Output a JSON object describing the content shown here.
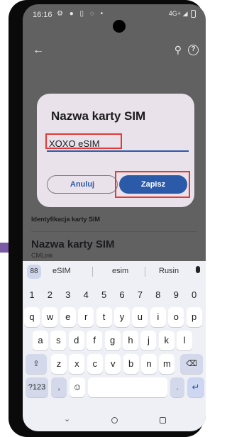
{
  "status_bar": {
    "time": "16:16",
    "icons": "⚙ ● ▯ ◌ •",
    "network": "4G+"
  },
  "app_bar": {
    "back_icon": "←",
    "search_icon": "⚲",
    "help_icon": "?"
  },
  "dialog": {
    "title": "Nazwa karty SIM",
    "input_value": "XOXO eSIM",
    "cancel_label": "Anuluj",
    "save_label": "Zapisz"
  },
  "settings": {
    "section_header": "Identyfikacja karty SIM",
    "item_title": "Nazwa karty SIM",
    "item_value": "CMLink"
  },
  "keyboard": {
    "suggestions": [
      "eSIM",
      "esim",
      "Rusin"
    ],
    "grid_icon": "88",
    "number_row": [
      "1",
      "2",
      "3",
      "4",
      "5",
      "6",
      "7",
      "8",
      "9",
      "0"
    ],
    "row1": [
      "q",
      "w",
      "e",
      "r",
      "t",
      "y",
      "u",
      "i",
      "o",
      "p"
    ],
    "row2": [
      "a",
      "s",
      "d",
      "f",
      "g",
      "h",
      "j",
      "k",
      "l"
    ],
    "row3": [
      "z",
      "x",
      "c",
      "v",
      "b",
      "n",
      "m"
    ],
    "shift_icon": "⇧",
    "backspace_icon": "⌫",
    "symbols_label": "?123",
    "comma": ",",
    "emoji_icon": "☺",
    "period": ".",
    "enter_icon": "↵"
  },
  "nav_bar": {
    "back_icon": "⌄"
  }
}
